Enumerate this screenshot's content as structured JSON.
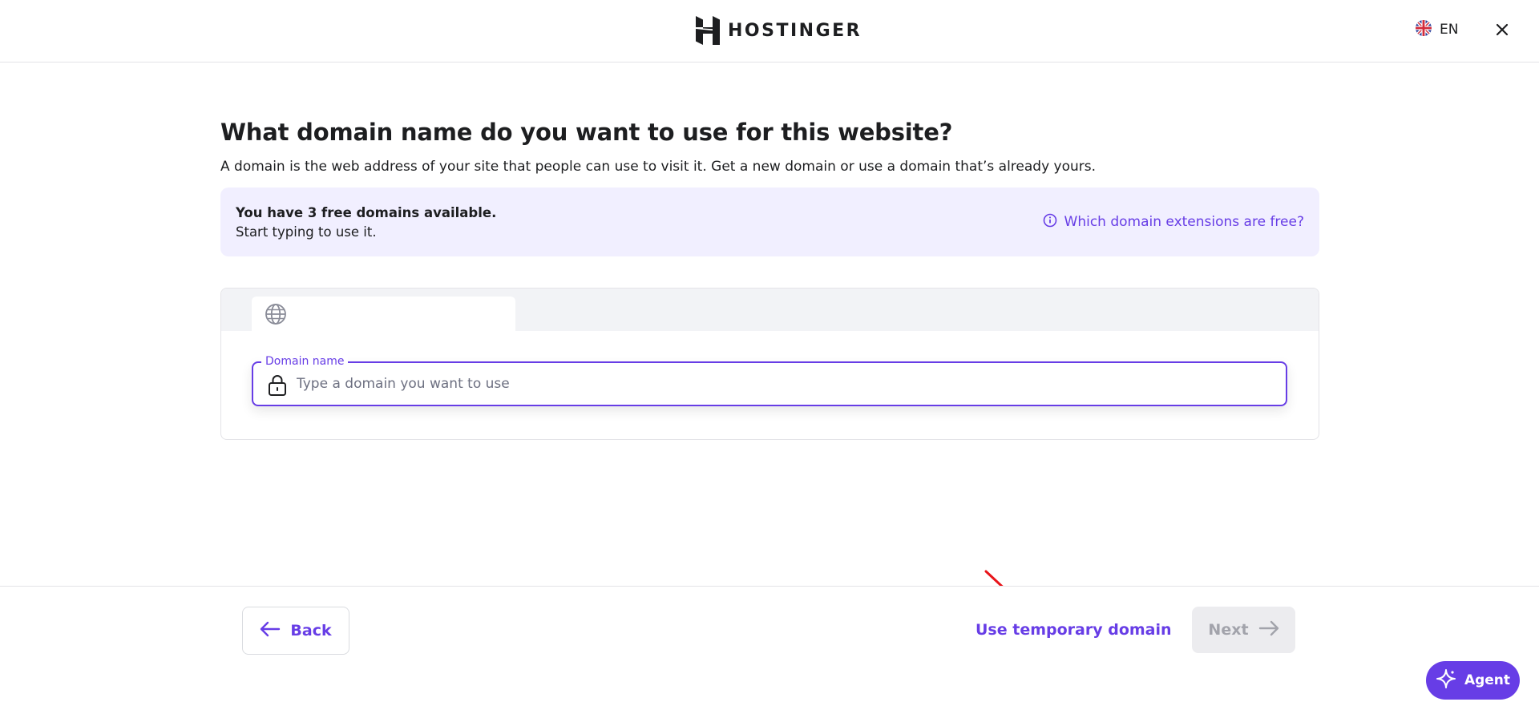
{
  "header": {
    "brand": "HOSTINGER",
    "language": "EN",
    "icons": {
      "logo": "hostinger-logo-icon",
      "flag": "uk-flag-icon",
      "close": "close-icon"
    }
  },
  "main": {
    "title": "What domain name do you want to use for this website?",
    "description": "A domain is the web address of your site that people can use to visit it. Get a new domain or use a domain that’s already yours."
  },
  "info_box": {
    "title": "You have 3 free domains available.",
    "subtitle": "Start typing to use it.",
    "link_label": "Which domain extensions are free?",
    "link_icon": "info-circle-icon"
  },
  "domain_card": {
    "tab_icon": "globe-icon",
    "field_label": "Domain name",
    "field_value": "",
    "field_placeholder": "Type a domain you want to use",
    "field_icon": "lock-icon"
  },
  "footer": {
    "back_label": "Back",
    "temp_domain_label": "Use temporary domain",
    "next_label": "Next",
    "next_enabled": false
  },
  "agent": {
    "label": "Agent",
    "icon": "sparkle-icon"
  },
  "colors": {
    "accent": "#673de6",
    "info_bg": "#f1efff",
    "text": "#1d1e20",
    "muted": "#6d7081",
    "disabled_bg": "#ececef",
    "disabled_text": "#a2a3ab",
    "annotation": "#e8141a"
  }
}
